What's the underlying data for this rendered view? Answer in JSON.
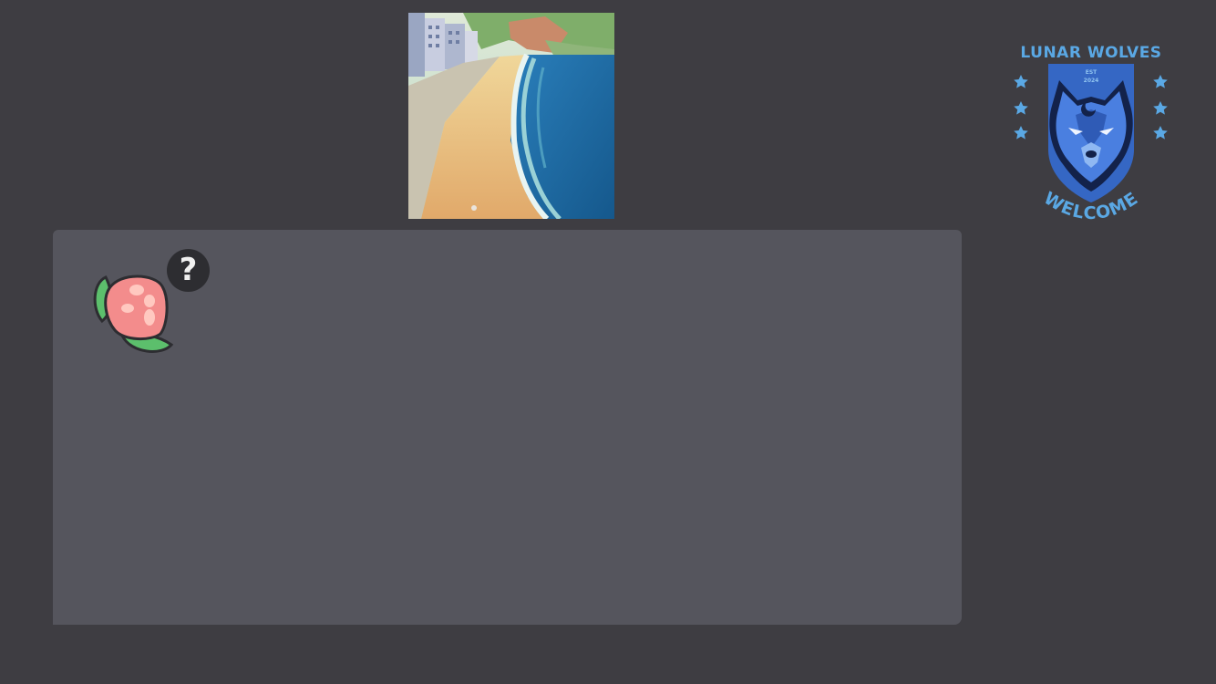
{
  "scene": {
    "icon": "coastal-beach-road-scene",
    "colors": {
      "sea": "#1f6fa8",
      "sand": "#e9c27a",
      "cliff": "#c98a6a"
    }
  },
  "panel": {
    "item": {
      "icon": "pink-berry-with-green-leaves",
      "badge_text": "?"
    }
  },
  "crest": {
    "title": "LUNAR WOLVES",
    "est_label": "EST",
    "est_year": "2024",
    "tagline": "WELCOME",
    "colors": {
      "accent": "#5aa8e4",
      "shield": "#3567c4"
    }
  }
}
